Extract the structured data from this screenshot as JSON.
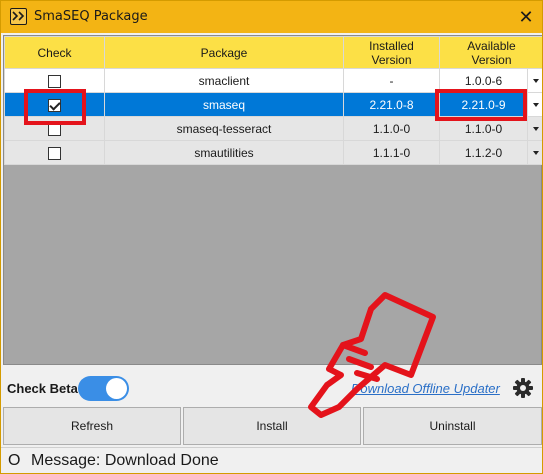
{
  "window": {
    "title": "SmaSEQ Package",
    "close_label": "✕"
  },
  "table": {
    "headers": {
      "check": "Check",
      "package": "Package",
      "installed": "Installed\nVersion",
      "available": "Available\nVersion"
    },
    "rows": [
      {
        "checked": false,
        "package": "smaclient",
        "installed": "-",
        "available": "1.0.0-6",
        "selected": false
      },
      {
        "checked": true,
        "package": "smaseq",
        "installed": "2.21.0-8",
        "available": "2.21.0-9",
        "selected": true
      },
      {
        "checked": false,
        "package": "smaseq-tesseract",
        "installed": "1.1.0-0",
        "available": "1.1.0-0",
        "selected": false
      },
      {
        "checked": false,
        "package": "smautilities",
        "installed": "1.1.1-0",
        "available": "1.1.2-0",
        "selected": false
      }
    ]
  },
  "beta": {
    "label": "Check Beta",
    "enabled": true
  },
  "download_link": "Download Offline Updater",
  "buttons": {
    "refresh": "Refresh",
    "install": "Install",
    "uninstall": "Uninstall"
  },
  "status": {
    "icon": "O",
    "message": "Message: Download Done"
  },
  "colors": {
    "titlebar": "#f3b414",
    "header": "#fce046",
    "selected": "#0078d7",
    "highlight": "#e4131b",
    "toggle": "#3a8ee6"
  }
}
